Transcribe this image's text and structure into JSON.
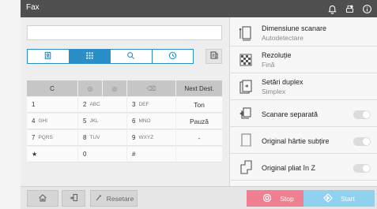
{
  "titlebar": {
    "title": "Fax",
    "icons": [
      "bell-icon",
      "wifi-printer-icon",
      "info-icon"
    ]
  },
  "destination": {
    "value": ""
  },
  "mode_tabs": [
    {
      "icon": "address-book-icon",
      "active": false
    },
    {
      "icon": "keypad-icon",
      "active": true
    },
    {
      "icon": "search-icon",
      "active": false
    },
    {
      "icon": "history-icon",
      "active": false
    }
  ],
  "keypad": {
    "top_row": [
      "C",
      "◎",
      "◎",
      "⌫",
      "Next Dest."
    ],
    "rows": [
      [
        {
          "main": "1",
          "sub": ""
        },
        {
          "main": "2",
          "sub": "ABC"
        },
        {
          "main": "3",
          "sub": "DEF"
        },
        {
          "main": "Ton",
          "sub": ""
        }
      ],
      [
        {
          "main": "4",
          "sub": "GHI"
        },
        {
          "main": "5",
          "sub": "JKL"
        },
        {
          "main": "6",
          "sub": "MNO"
        },
        {
          "main": "Pauză",
          "sub": ""
        }
      ],
      [
        {
          "main": "7",
          "sub": "PQRS"
        },
        {
          "main": "8",
          "sub": "TUV"
        },
        {
          "main": "9",
          "sub": "WXYZ"
        },
        {
          "main": "-",
          "sub": ""
        }
      ],
      [
        {
          "main": "★",
          "sub": ""
        },
        {
          "main": "0",
          "sub": ""
        },
        {
          "main": "#",
          "sub": ""
        },
        {
          "main": "",
          "sub": ""
        }
      ]
    ]
  },
  "settings": [
    {
      "label": "Dimensiune scanare",
      "value": "Autodetectare",
      "icon": "scan-size-icon"
    },
    {
      "label": "Rezoluție",
      "value": "Fină",
      "icon": "resolution-icon"
    },
    {
      "label": "Setări duplex",
      "value": "Simplex",
      "icon": "duplex-icon"
    },
    {
      "label": "Scanare separată",
      "toggle": false,
      "icon": "separate-scan-icon"
    },
    {
      "label": "Original hârtie subțire",
      "toggle": false,
      "icon": "thin-paper-icon"
    },
    {
      "label": "Original pliat în Z",
      "toggle": false,
      "icon": "z-fold-icon"
    }
  ],
  "bottom": {
    "reset_label": "Resetare",
    "stop_label": "Stop",
    "start_label": "Start"
  },
  "colors": {
    "accent": "#2a8fc6",
    "stop": "#f07f92",
    "start": "#8fd1ef",
    "titlebar": "#4f4f4f"
  }
}
